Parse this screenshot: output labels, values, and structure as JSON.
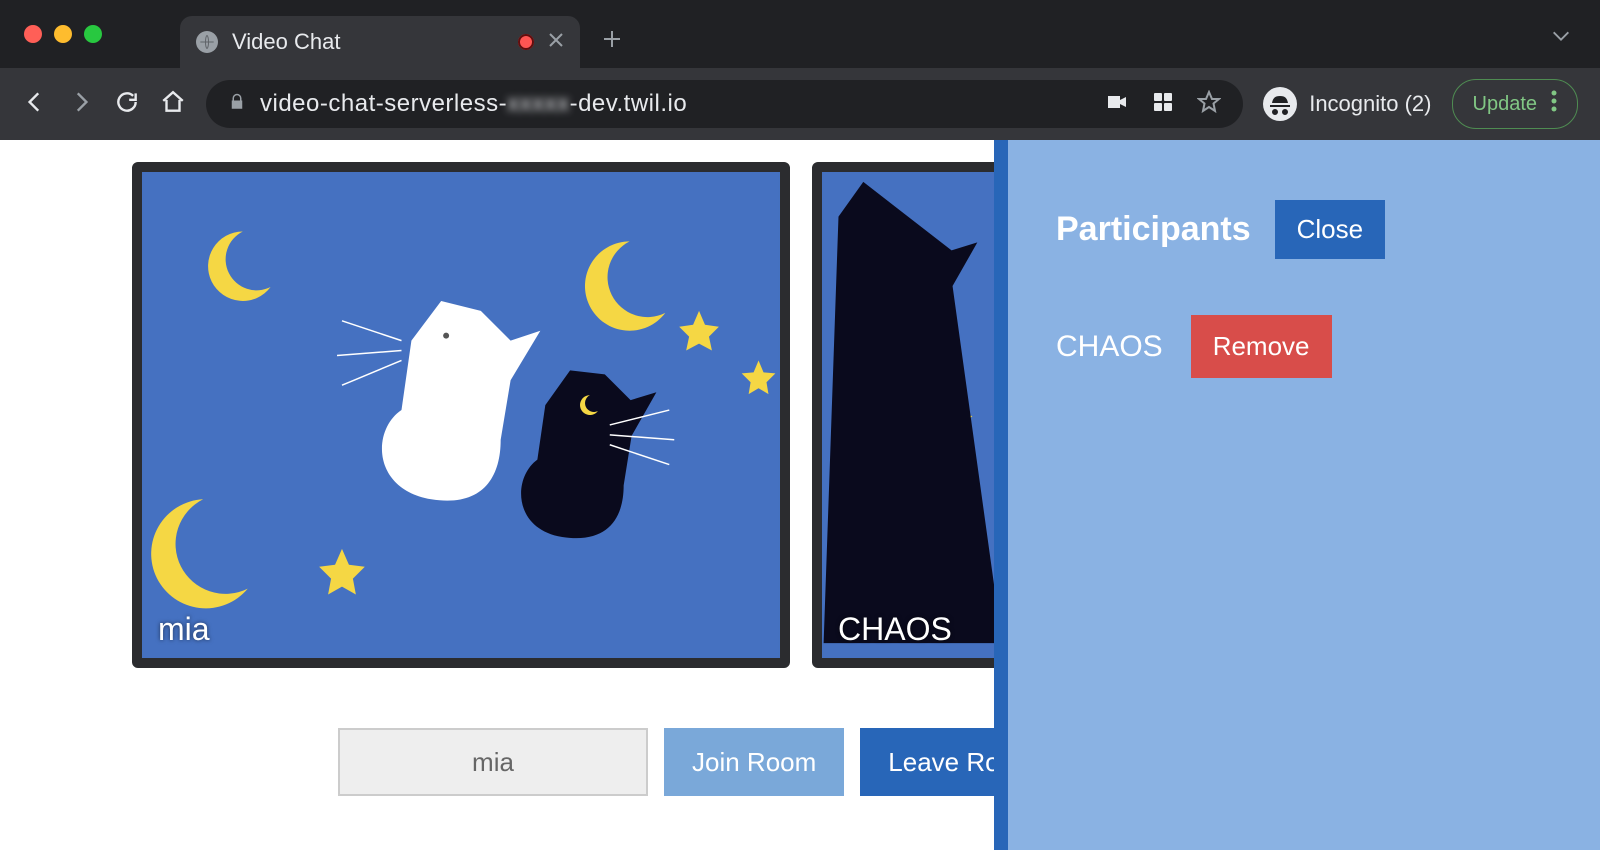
{
  "browser": {
    "tab_title": "Video Chat",
    "url_pre": "video-chat-serverless-",
    "url_blur": "xxxxx",
    "url_post": "-dev.twil.io",
    "incognito_label": "Incognito (2)",
    "update_label": "Update"
  },
  "videos": [
    {
      "name": "mia"
    },
    {
      "name": "CHAOS"
    }
  ],
  "controls": {
    "name_value": "mia",
    "join_label": "Join Room",
    "leave_label": "Leave Room"
  },
  "panel": {
    "title": "Participants",
    "close_label": "Close",
    "participants": [
      {
        "name": "CHAOS",
        "remove_label": "Remove"
      }
    ]
  }
}
